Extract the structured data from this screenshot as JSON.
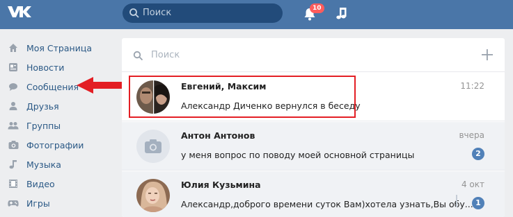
{
  "topbar": {
    "logo_text": "VK",
    "search_placeholder": "Поиск",
    "notifications_badge": "10"
  },
  "menu": [
    {
      "label": "Моя Страница",
      "icon": "home-icon"
    },
    {
      "label": "Новости",
      "icon": "news-icon"
    },
    {
      "label": "Сообщения",
      "icon": "messages-icon"
    },
    {
      "label": "Друзья",
      "icon": "friends-icon"
    },
    {
      "label": "Группы",
      "icon": "groups-icon"
    },
    {
      "label": "Фотографии",
      "icon": "photos-icon"
    },
    {
      "label": "Музыка",
      "icon": "music-icon"
    },
    {
      "label": "Видео",
      "icon": "video-icon"
    },
    {
      "label": "Игры",
      "icon": "games-icon"
    }
  ],
  "messages": {
    "search_placeholder": "Поиск",
    "dialogs": [
      {
        "name": "Евгений, Максим",
        "text": "Александр Диченко вернулся в беседу",
        "time": "11:22",
        "count": ""
      },
      {
        "name": "Антон Антонов",
        "text": "у меня вопрос по поводу моей основной страницы",
        "time": "вчера",
        "count": "2"
      },
      {
        "name": "Юлия Кузьмина",
        "text": "Александр,доброго времени суток Вам)хотела узнать,Вы обу...",
        "time": "4 окт",
        "count": "1"
      }
    ]
  },
  "colors": {
    "header": "#4a76a8",
    "link": "#2a5885",
    "highlight": "#e31e24",
    "badge": "#ff5c5c",
    "counter": "#5181b8"
  }
}
